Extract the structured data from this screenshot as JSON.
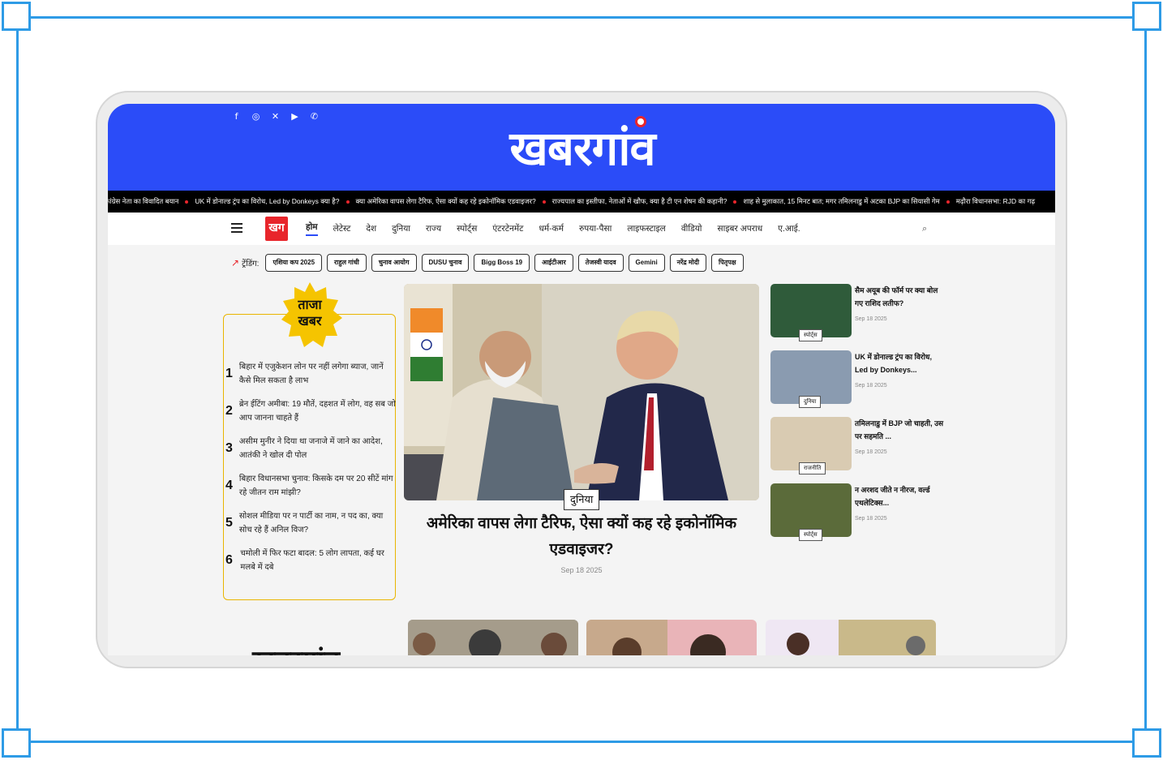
{
  "social_icons": [
    "facebook-icon",
    "instagram-icon",
    "x-icon",
    "youtube-icon",
    "whatsapp-icon"
  ],
  "brand": {
    "logo_text": "खबरगांव",
    "nav_logo_text": "खग"
  },
  "ticker": [
    "कांग्रेस नेता का विवादित बयान",
    "UK में डोनाल्ड ट्रंप का विरोध, Led by Donkeys क्या है?",
    "क्या अमेरिका वापस लेगा टैरिफ, ऐसा क्यों कह रहे इकोनॉमिक एडवाइजर?",
    "राज्यपाल का इस्तीफा, नेताओं में खौफ, क्या है टी एन शेषन की कहानी?",
    "शाह से मुलाकात, 15 मिनट बात; मगर तमिलनाडु में अटका BJP का सियासी गेम",
    "मढ़ौरा विधानसभा: RJD का गढ़"
  ],
  "nav": {
    "items": [
      "होम",
      "लेटेस्ट",
      "देश",
      "दुनिया",
      "राज्य",
      "स्पोर्ट्स",
      "एंटरटेनमेंट",
      "धर्म-कर्म",
      "रुपया-पैसा",
      "लाइफस्टाइल",
      "वीडियो",
      "साइबर अपराध",
      "ए.आई."
    ],
    "active": "होम"
  },
  "trending": {
    "label": "ट्रेंडिंग:",
    "chips": [
      "एशिया कप 2025",
      "राहुल गांधी",
      "चुनाव आयोग",
      "DUSU चुनाव",
      "Bigg Boss 19",
      "आईटीआर",
      "तेजस्वी यादव",
      "Gemini",
      "नरेंद्र मोदी",
      "पितृपक्ष"
    ]
  },
  "taaza": {
    "title_line1": "ताजा",
    "title_line2": "खबर",
    "items": [
      {
        "num": "1",
        "text": "बिहार में एजुकेशन लोन पर नहीं लगेगा ब्याज, जानें कैसे मिल सकता है लाभ"
      },
      {
        "num": "2",
        "text": "ब्रेन ईटिंग अमीबा: 19 मौतें, दहशत में लोग, वह सब जो आप जानना चाहते हैं"
      },
      {
        "num": "3",
        "text": "असीम मुनीर ने दिया था जनाजे में जाने का आदेश, आतंकी ने खोल दी पोल"
      },
      {
        "num": "4",
        "text": "बिहार विधानसभा चुनाव: किसके दम पर 20 सीटें मांग रहे जीतन राम मांझी?"
      },
      {
        "num": "5",
        "text": "सोशल मीडिया पर न पार्टी का नाम, न पद का, क्या सोच रहे हैं अनिल विज?"
      },
      {
        "num": "6",
        "text": "चमोली में फिर फटा बादल: 5 लोग लापता, कई घर मलबे में दबे"
      }
    ]
  },
  "hero": {
    "tag": "दुनिया",
    "title": "अमेरिका वापस लेगा टैरिफ, ऐसा क्यों कह रहे इकोनॉमिक एडवाइजर?",
    "date": "Sep 18 2025"
  },
  "side": [
    {
      "tag": "स्पोर्ट्स",
      "title": "सैम अयूब की फॉर्म पर क्या बोल गए राशिद लतीफ?",
      "date": "Sep 18 2025",
      "color": "#2f5b3a"
    },
    {
      "tag": "दुनिया",
      "title": "UK में डोनाल्ड ट्रंप का विरोध, Led by Donkeys...",
      "date": "Sep 18 2025",
      "color": "#8a9bb0"
    },
    {
      "tag": "राजनीति",
      "title": "तमिलनाडु में BJP जो चाहती, उस पर सहमति ...",
      "date": "Sep 18 2025",
      "color": "#d9cbb2"
    },
    {
      "tag": "स्पोर्ट्स",
      "title": "न अरशद जीते न नीरज, वर्ल्ड एथलेटिक्स...",
      "date": "Sep 18 2025",
      "color": "#5b6b3a"
    }
  ],
  "bottom": {
    "logo_text": "खबरगांव"
  },
  "colors": {
    "brand_blue": "#2b4cf8",
    "accent_red": "#e8252b",
    "taaza_yellow": "#f5c400",
    "frame_blue": "#2e9be6"
  }
}
